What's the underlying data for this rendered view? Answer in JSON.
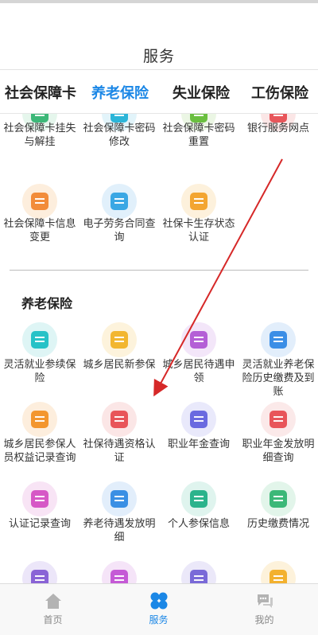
{
  "header": {
    "title": "服务"
  },
  "tabs": [
    {
      "label": "社会保障卡"
    },
    {
      "label": "养老保险"
    },
    {
      "label": "失业保险"
    },
    {
      "label": "工伤保险"
    }
  ],
  "active_tab": 1,
  "card_section": {
    "items": [
      {
        "label": "社会保障卡挂失与解挂",
        "icon": "card-lock-icon",
        "color": "#3cb878",
        "bg": "#e5f6ec"
      },
      {
        "label": "社会保障卡密码修改",
        "icon": "card-edit-icon",
        "color": "#2bb5d8",
        "bg": "#e2f4fa"
      },
      {
        "label": "社会保障卡密码重置",
        "icon": "card-reset-icon",
        "color": "#6abf3f",
        "bg": "#ebf6e4"
      },
      {
        "label": "银行服务网点",
        "icon": "bank-icon",
        "color": "#e8555a",
        "bg": "#fbe6e6"
      },
      {
        "label": "社会保障卡信息变更",
        "icon": "card-info-icon",
        "color": "#f28c3a",
        "bg": "#fdeedd"
      },
      {
        "label": "电子劳务合同查询",
        "icon": "contract-icon",
        "color": "#3aa7e4",
        "bg": "#e1f0fb"
      },
      {
        "label": "社保卡生存状态认证",
        "icon": "certify-icon",
        "color": "#f3a531",
        "bg": "#fdf1dc"
      }
    ]
  },
  "pension_section": {
    "title": "养老保险",
    "items": [
      {
        "label": "灵活就业参续保险",
        "icon": "flex-insure-icon",
        "color": "#27c2c7",
        "bg": "#def5f5"
      },
      {
        "label": "城乡居民新参保",
        "icon": "new-insure-icon",
        "color": "#f2b630",
        "bg": "#fdf3dc"
      },
      {
        "label": "城乡居民待遇申领",
        "icon": "benefit-apply-icon",
        "color": "#b45fd6",
        "bg": "#f3e6f9"
      },
      {
        "label": "灵活就业养老保险历史缴费及到账",
        "icon": "payment-history-icon",
        "color": "#3b8ee6",
        "bg": "#e2eefb"
      },
      {
        "label": "城乡居民参保人员权益记录查询",
        "icon": "record-query-icon",
        "color": "#f3962e",
        "bg": "#fdeedd"
      },
      {
        "label": "社保待遇资格认证",
        "icon": "medal-icon",
        "color": "#e8555a",
        "bg": "#fbe6e6"
      },
      {
        "label": "职业年金查询",
        "icon": "coins-icon",
        "color": "#6a6ae0",
        "bg": "#e9e9fb"
      },
      {
        "label": "职业年金发放明细查询",
        "icon": "receipt-icon",
        "color": "#e8555a",
        "bg": "#fbe9e9"
      },
      {
        "label": "认证记录查询",
        "icon": "cert-record-icon",
        "color": "#d658c6",
        "bg": "#f8e4f5"
      },
      {
        "label": "养老待遇发放明细",
        "icon": "pension-detail-icon",
        "color": "#3a8fe4",
        "bg": "#e2eefb"
      },
      {
        "label": "个人参保信息",
        "icon": "person-info-icon",
        "color": "#2bb38c",
        "bg": "#dff4ee"
      },
      {
        "label": "历史缴费情况",
        "icon": "history-pay-icon",
        "color": "#3cb878",
        "bg": "#e2f5ea"
      },
      {
        "label": "",
        "icon": "partial-icon-1",
        "color": "#8a64d6",
        "bg": "#ece6f9"
      },
      {
        "label": "",
        "icon": "partial-icon-2",
        "color": "#c55ad6",
        "bg": "#f5e4f8"
      },
      {
        "label": "",
        "icon": "partial-icon-3",
        "color": "#7a6ad8",
        "bg": "#ebe8f9"
      },
      {
        "label": "",
        "icon": "partial-icon-4",
        "color": "#f3b12e",
        "bg": "#fdf2db"
      }
    ]
  },
  "bottom_nav": [
    {
      "label": "首页",
      "icon": "home-icon"
    },
    {
      "label": "服务",
      "icon": "services-icon"
    },
    {
      "label": "我的",
      "icon": "chat-icon"
    }
  ],
  "active_nav": 1,
  "accent_color": "#1b87e6",
  "annotation_arrow_color": "#d62828"
}
